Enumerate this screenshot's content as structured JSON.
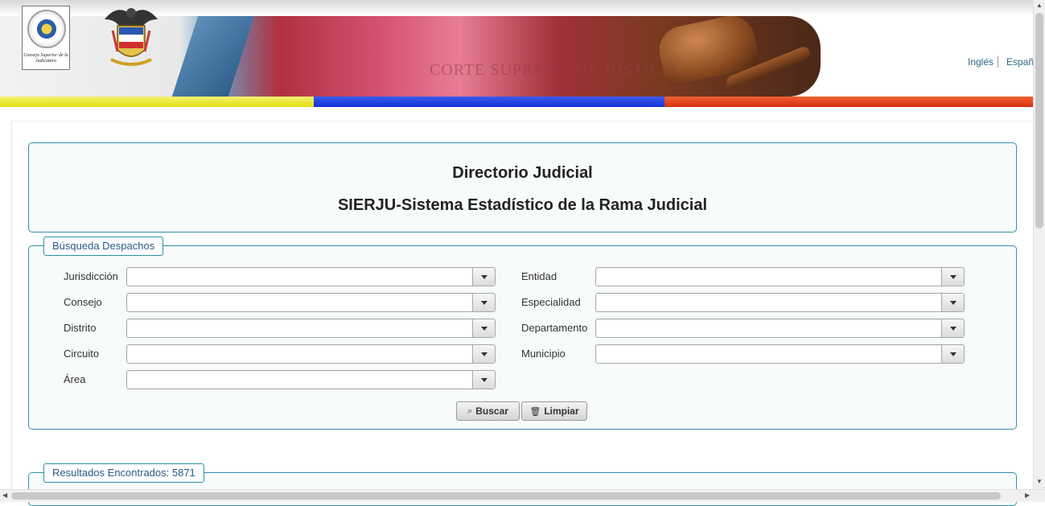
{
  "header": {
    "banner_text": "CORTE SUPREMA DE JUSTICIA",
    "seal_text": "Consejo Superior de la Judicatura",
    "languages": [
      "Inglés",
      "Español"
    ]
  },
  "title": {
    "line1": "Directorio Judicial",
    "line2": "SIERJU-Sistema Estadístico de la Rama Judicial"
  },
  "search": {
    "legend": "Búsqueda Despachos",
    "left_fields": [
      "Jurisdicción",
      "Consejo",
      "Distrito",
      "Circuito",
      "Área"
    ],
    "right_fields": [
      "Entidad",
      "Especialidad",
      "Departamento",
      "Municipio"
    ],
    "buttons": {
      "search": "Buscar",
      "clear": "Limpiar"
    }
  },
  "results": {
    "legend": "Resultados Encontrados: 5871"
  },
  "icons": {
    "search": "magnifier-icon",
    "clear": "trash-icon",
    "dropdown": "chevron-down-icon"
  }
}
